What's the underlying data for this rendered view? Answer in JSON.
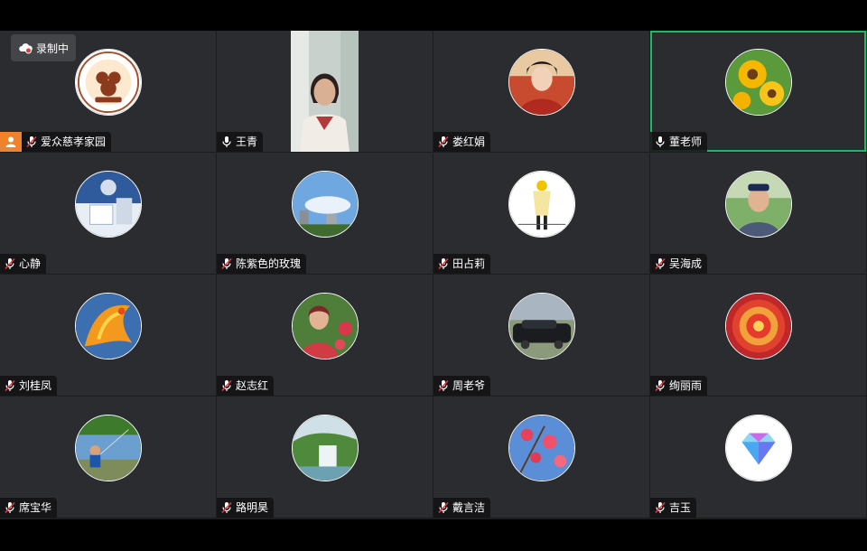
{
  "recording": {
    "label": "录制中",
    "icon": "cloud-record-icon"
  },
  "participants": [
    {
      "name": "爱众慈孝家园",
      "mic": "muted",
      "host": true,
      "avatar_logo_text": "爱众慈孝家园"
    },
    {
      "name": "王青",
      "mic": "on",
      "video": true
    },
    {
      "name": "娄红娟",
      "mic": "muted"
    },
    {
      "name": "董老师",
      "mic": "on",
      "speaking": true
    },
    {
      "name": "心静",
      "mic": "muted"
    },
    {
      "name": "陈紫色的玫瑰",
      "mic": "muted"
    },
    {
      "name": "田占莉",
      "mic": "muted"
    },
    {
      "name": "吴海成",
      "mic": "muted"
    },
    {
      "name": "刘桂凤",
      "mic": "muted"
    },
    {
      "name": "赵志红",
      "mic": "muted"
    },
    {
      "name": "周老爷",
      "mic": "muted"
    },
    {
      "name": "绚丽雨",
      "mic": "muted"
    },
    {
      "name": "席宝华",
      "mic": "muted"
    },
    {
      "name": "路明昊",
      "mic": "muted"
    },
    {
      "name": "戴言洁",
      "mic": "muted"
    },
    {
      "name": "吉玉",
      "mic": "muted"
    }
  ],
  "colors": {
    "active_border": "#22b862",
    "host_badge": "#f0832a",
    "muted_icon": "#e03c3c",
    "tile_bg": "#2a2c2f"
  }
}
